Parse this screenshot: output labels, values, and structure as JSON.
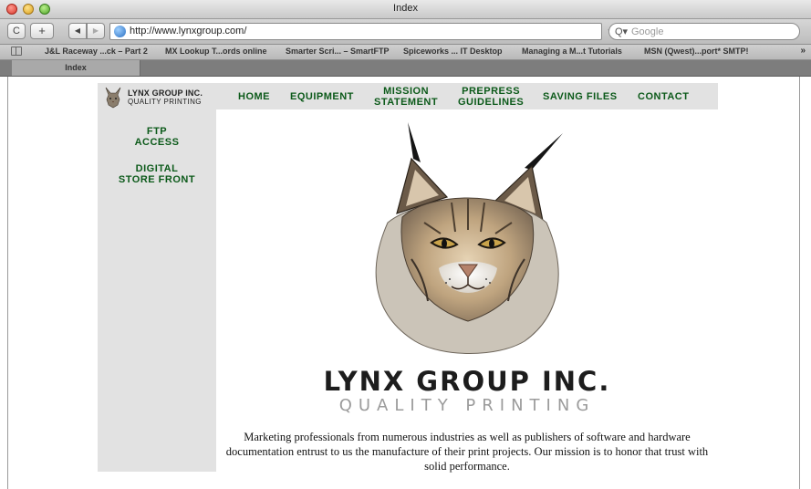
{
  "window": {
    "title": "Index"
  },
  "toolbar": {
    "reload_glyph": "C",
    "add_glyph": "+",
    "back_glyph": "◀",
    "forward_glyph": "▶",
    "url": "http://www.lynxgroup.com/",
    "search_placeholder": "Google",
    "search_glyph": "Q▾"
  },
  "bookmarks": [
    "J&L Raceway ...ck – Part 2",
    "MX Lookup T...ords online",
    "Smarter Scri... – SmartFTP",
    "Spiceworks ... IT Desktop",
    "Managing a M...t Tutorials",
    "MSN (Qwest)...port* SMTP!"
  ],
  "bookmarks_more": "»",
  "tabs": [
    {
      "label": "Index"
    }
  ],
  "site": {
    "logo_name": "LYNX GROUP INC.",
    "logo_tagline": "QUALITY PRINTING",
    "nav": [
      {
        "line1": "HOME",
        "line2": ""
      },
      {
        "line1": "EQUIPMENT",
        "line2": ""
      },
      {
        "line1": "MISSION",
        "line2": "STATEMENT"
      },
      {
        "line1": "PREPRESS",
        "line2": "GUIDELINES"
      },
      {
        "line1": "SAVING FILES",
        "line2": ""
      },
      {
        "line1": "CONTACT",
        "line2": ""
      }
    ],
    "sidebar": [
      {
        "line1": "FTP",
        "line2": "ACCESS"
      },
      {
        "line1": "DIGITAL",
        "line2": "STORE FRONT"
      }
    ],
    "brand_name": "LYNX GROUP INC.",
    "brand_tagline": "QUALITY PRINTING",
    "mission": "Marketing professionals from numerous industries as well as publishers of software and hardware documentation entrust to us the manufacture of their print projects. Our mission is to honor that trust with solid performance."
  },
  "colors": {
    "nav_green": "#0c5a1a",
    "panel_gray": "#e2e2e2"
  }
}
